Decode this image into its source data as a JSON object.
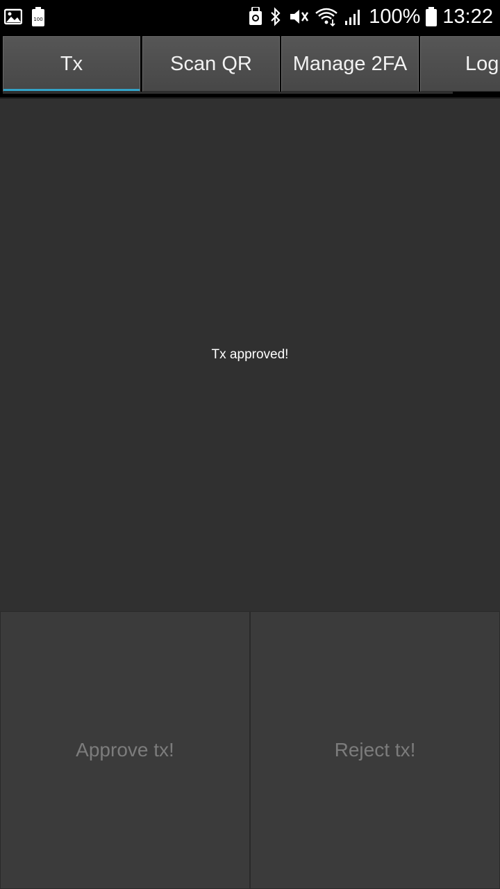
{
  "status_bar": {
    "icons_left": [
      "image-icon",
      "battery-100-icon"
    ],
    "icons_right": [
      "lock-sync-icon",
      "bluetooth-icon",
      "vibrate-mute-icon",
      "wifi-icon",
      "signal-icon"
    ],
    "battery_percent": "100%",
    "time": "13:22"
  },
  "tabs": [
    {
      "label": "Tx",
      "active": true
    },
    {
      "label": "Scan QR",
      "active": false
    },
    {
      "label": "Manage 2FA",
      "active": false
    },
    {
      "label": "Log",
      "active": false
    }
  ],
  "main": {
    "message": "Tx approved!"
  },
  "actions": {
    "approve_label": "Approve tx!",
    "reject_label": "Reject tx!"
  },
  "colors": {
    "accent": "#33a3c8",
    "background": "#303030",
    "button_bg": "#3b3b3b",
    "button_text": "#7c7c7c"
  }
}
